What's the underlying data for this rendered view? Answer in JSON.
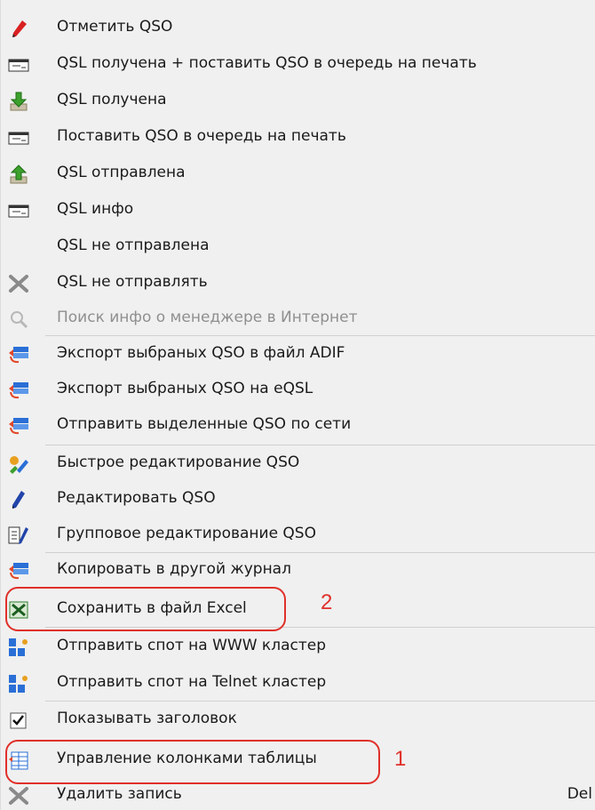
{
  "menu": {
    "items": [
      {
        "label": "Отметить QSO",
        "icon": "pen-mark-icon"
      },
      {
        "label": "QSL получена + поставить QSO в очередь на печать",
        "icon": "card-icon"
      },
      {
        "label": "QSL получена",
        "icon": "down-arrow-icon"
      },
      {
        "label": "Поставить QSO в очередь на печать",
        "icon": "card-icon"
      },
      {
        "label": "QSL отправлена",
        "icon": "up-arrow-icon"
      },
      {
        "label": "QSL инфо",
        "icon": "card-icon"
      },
      {
        "label": "QSL не отправлена",
        "icon": ""
      },
      {
        "label": "QSL не отправлять",
        "icon": "x-icon"
      },
      {
        "label": "Поиск инфо о менеджере в Интернет",
        "icon": "search-icon",
        "disabled": true
      },
      {
        "label": "Экспорт выбраных QSO в файл ADIF",
        "icon": "export-icon"
      },
      {
        "label": "Экспорт выбраных QSO на eQSL",
        "icon": "export-icon"
      },
      {
        "label": "Отправить выделенные QSO по сети",
        "icon": "export-icon"
      },
      {
        "label": "Быстрое редактирование QSO",
        "icon": "quick-edit-icon"
      },
      {
        "label": "Редактировать QSO",
        "icon": "pencil-icon"
      },
      {
        "label": "Групповое редактирование QSO",
        "icon": "group-edit-icon"
      },
      {
        "label": "Копировать в другой журнал",
        "icon": "export-icon"
      },
      {
        "label": "Сохранить в файл Excel",
        "icon": "excel-icon"
      },
      {
        "label": "Отправить спот на WWW кластер",
        "icon": "cluster-icon"
      },
      {
        "label": "Отправить спот на Telnet кластер",
        "icon": "cluster-icon"
      },
      {
        "label": "Показывать заголовок",
        "icon": "checkbox-checked-icon"
      },
      {
        "label": "Управление колонками таблицы",
        "icon": "columns-icon"
      },
      {
        "label": "Удалить запись",
        "icon": "x-icon",
        "shortcut": "Del"
      }
    ]
  },
  "annotations": {
    "callout_1": "1",
    "callout_2": "2"
  },
  "colors": {
    "background": "#f0f0f0",
    "accent_red": "#e0302a",
    "text": "#1a1a1a",
    "disabled_text": "#8f8f8f"
  }
}
